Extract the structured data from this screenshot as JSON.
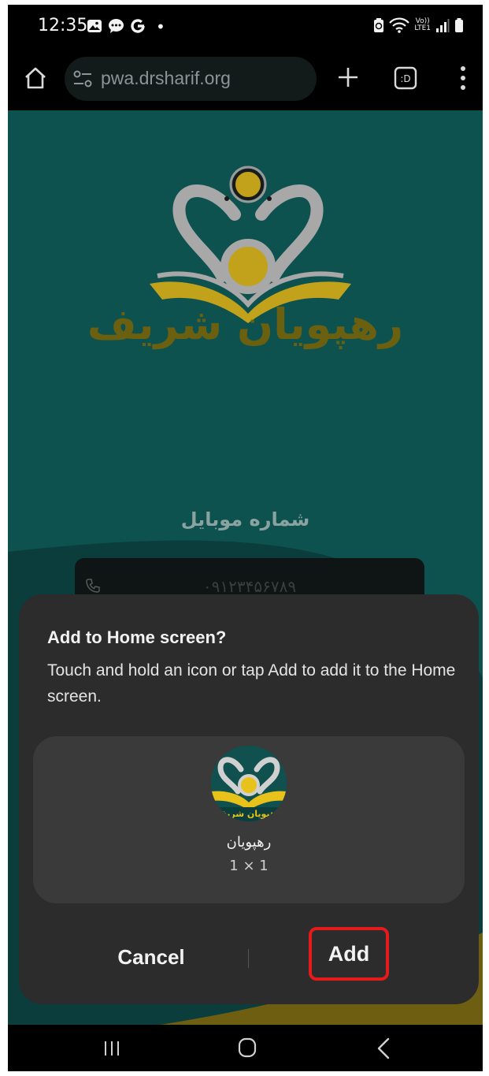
{
  "status_bar": {
    "time": "12:35",
    "dot": "•",
    "volte_top": "Vo))",
    "volte_bottom": "LTE1",
    "icons": [
      "gallery-icon",
      "chat-icon",
      "google-icon",
      "battery-saver-icon",
      "wifi-icon",
      "signal-icon",
      "battery-icon"
    ]
  },
  "browser": {
    "url": "pwa.drsharif.org",
    "tabs_label": ":D"
  },
  "web": {
    "brand_text": "رهپویان شریف",
    "mobile_label": "شماره موبایل",
    "phone_placeholder": "۰۹۱۲۳۴۵۶۷۸۹",
    "colors": {
      "background": "#0d4a48",
      "gold": "#c2a21a"
    }
  },
  "dialog": {
    "title": "Add to Home screen?",
    "message": "Touch and hold an icon or tap Add to add it to the Home screen.",
    "app_name": "رهپویان",
    "icon_text": "رهپویان شریف",
    "size": "1 × 1",
    "cancel_label": "Cancel",
    "add_label": "Add",
    "highlight_color": "#e51a1a"
  }
}
